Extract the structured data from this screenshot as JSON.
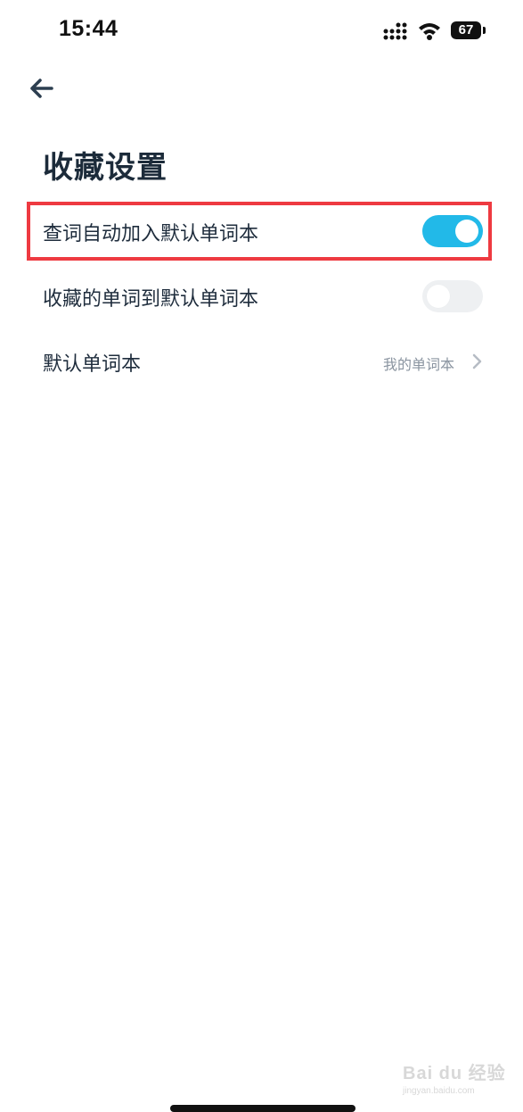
{
  "status_bar": {
    "time": "15:44",
    "battery": "67"
  },
  "header": {
    "back_icon": "arrow-left-icon",
    "title": "收藏设置"
  },
  "settings": {
    "auto_add": {
      "label": "查词自动加入默认单词本",
      "enabled": true
    },
    "fav_to_default": {
      "label": "收藏的单词到默认单词本",
      "enabled": false
    },
    "default_book": {
      "label": "默认单词本",
      "value": "我的单词本"
    }
  },
  "watermark": {
    "main": "Bai du 经验",
    "sub": "jingyan.baidu.com"
  },
  "colors": {
    "accent": "#22b9e8",
    "highlight": "#ee3a41",
    "toggle_off": "#eef0f2"
  }
}
